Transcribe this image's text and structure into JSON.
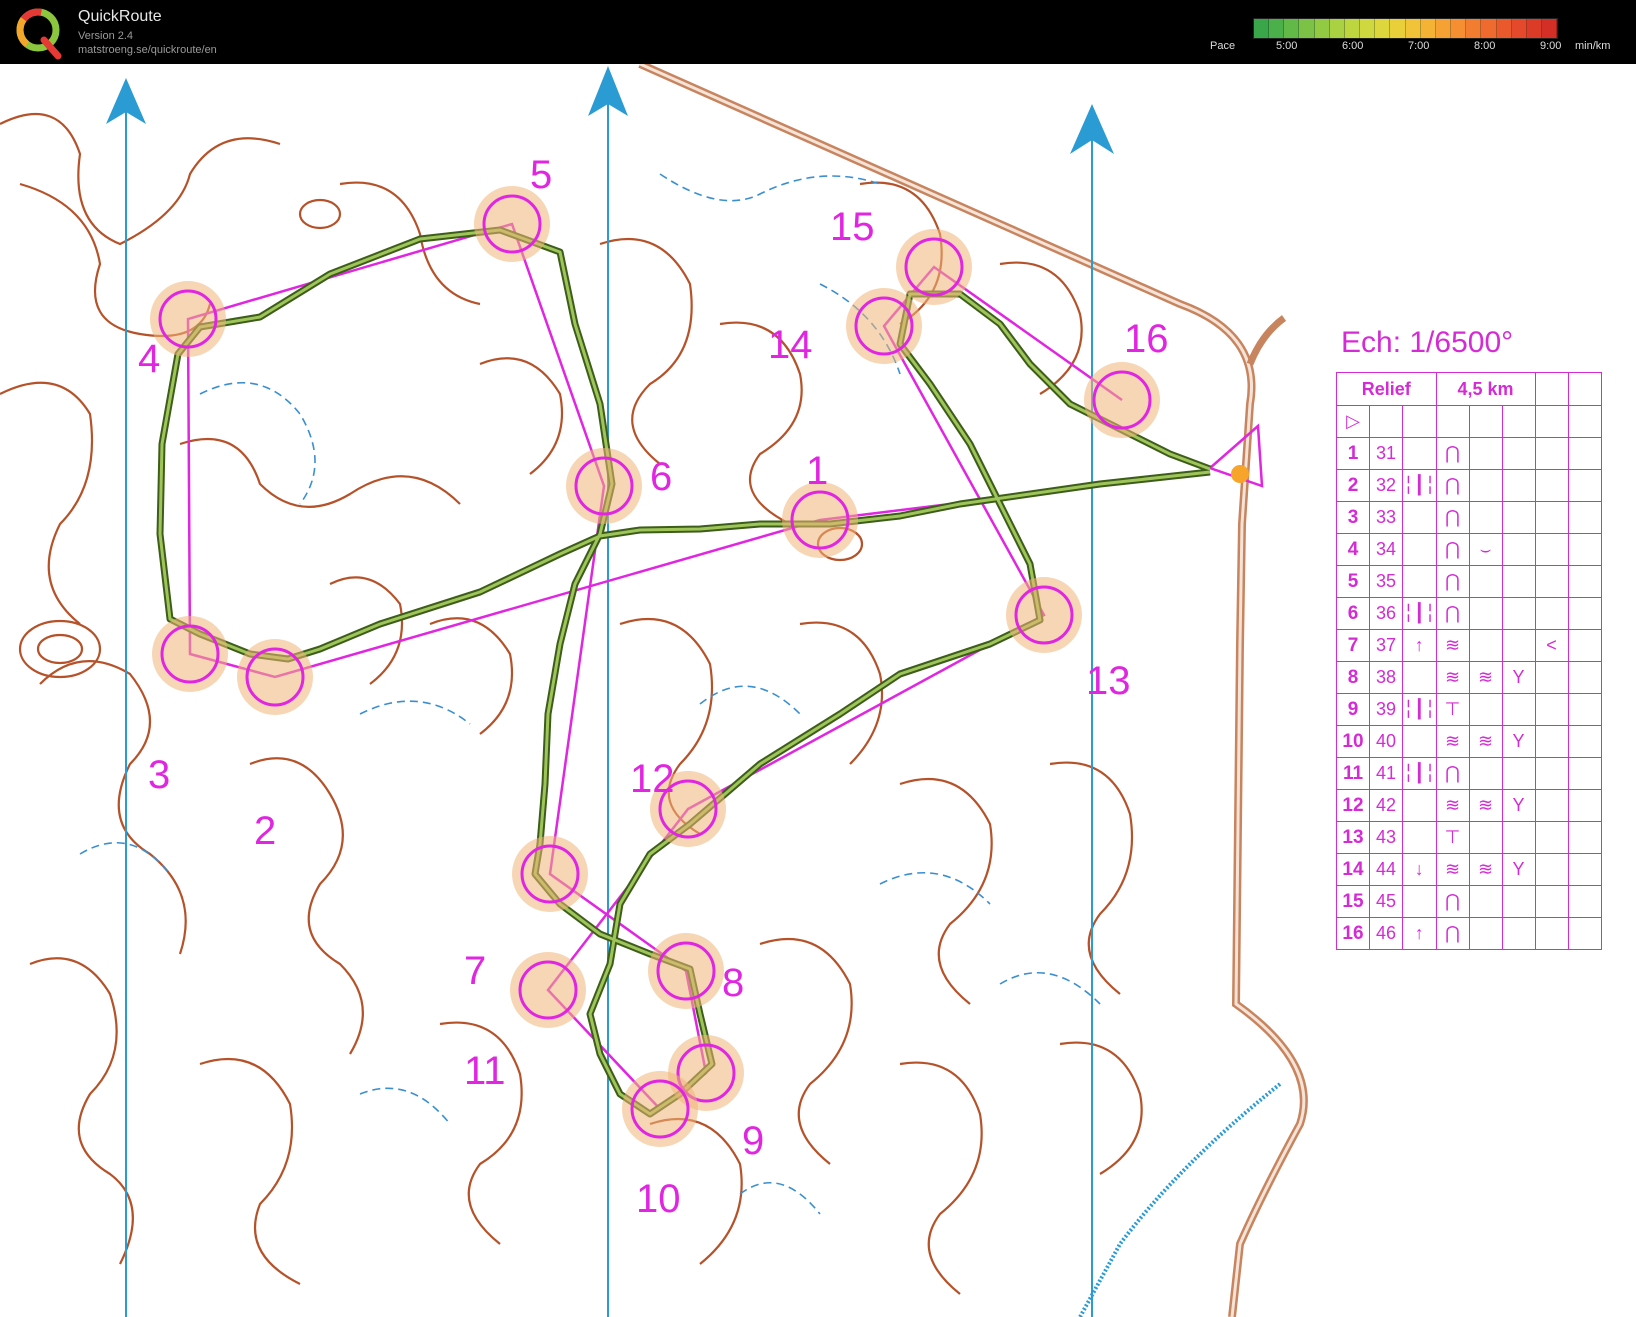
{
  "app": {
    "title": "QuickRoute",
    "version": "Version 2.4",
    "url": "matstroeng.se/quickroute/en"
  },
  "pace_scale": {
    "label": "Pace",
    "ticks": [
      "5:00",
      "6:00",
      "7:00",
      "8:00",
      "9:00"
    ],
    "unit": "min/km",
    "colors": [
      "#3aa64a",
      "#4cb04a",
      "#62b948",
      "#7bc246",
      "#93ca44",
      "#a9d142",
      "#bdd640",
      "#cfd83e",
      "#ddd63c",
      "#e9cf3a",
      "#f1c338",
      "#f5b336",
      "#f6a134",
      "#f58f32",
      "#f27c30",
      "#ee6a2e",
      "#e9592c",
      "#e3492a",
      "#dc3b28",
      "#d42f26"
    ]
  },
  "map": {
    "controls": [
      {
        "num": "1"
      },
      {
        "num": "2"
      },
      {
        "num": "3"
      },
      {
        "num": "4"
      },
      {
        "num": "5"
      },
      {
        "num": "6"
      },
      {
        "num": "7"
      },
      {
        "num": "8"
      },
      {
        "num": "9"
      },
      {
        "num": "10"
      },
      {
        "num": "11"
      },
      {
        "num": "12"
      },
      {
        "num": "13"
      },
      {
        "num": "14"
      },
      {
        "num": "15"
      },
      {
        "num": "16"
      }
    ],
    "colors": {
      "course": "#e026e0",
      "contour": "#b5522a",
      "water": "#3a8fd0",
      "route": "#5c8a2c",
      "road": "#c8845e",
      "north_line": "#2b9bd4"
    }
  },
  "description_sheet": {
    "scale": "Ech: 1/6500°",
    "header": {
      "climb": "Relief",
      "length": "4,5 km"
    },
    "start_symbol": "▷",
    "rows": [
      {
        "n": "1",
        "code": "31",
        "c": "",
        "d": "⋂",
        "e": "",
        "f": "",
        "g": ""
      },
      {
        "n": "2",
        "code": "32",
        "c": "╎┃╎",
        "d": "⋂",
        "e": "",
        "f": "",
        "g": ""
      },
      {
        "n": "3",
        "code": "33",
        "c": "",
        "d": "⋂",
        "e": "",
        "f": "",
        "g": ""
      },
      {
        "n": "4",
        "code": "34",
        "c": "",
        "d": "⋂",
        "e": "⌣",
        "f": "",
        "g": ""
      },
      {
        "n": "5",
        "code": "35",
        "c": "",
        "d": "⋂",
        "e": "",
        "f": "",
        "g": ""
      },
      {
        "n": "6",
        "code": "36",
        "c": "╎┃╎",
        "d": "⋂",
        "e": "",
        "f": "",
        "g": ""
      },
      {
        "n": "7",
        "code": "37",
        "c": "↑",
        "d": "≋",
        "e": "",
        "f": "",
        "g": "<"
      },
      {
        "n": "8",
        "code": "38",
        "c": "",
        "d": "≋",
        "e": "≋",
        "f": "Y",
        "g": ""
      },
      {
        "n": "9",
        "code": "39",
        "c": "╎┃╎",
        "d": "⊤",
        "e": "",
        "f": "",
        "g": ""
      },
      {
        "n": "10",
        "code": "40",
        "c": "",
        "d": "≋",
        "e": "≋",
        "f": "Y",
        "g": ""
      },
      {
        "n": "11",
        "code": "41",
        "c": "╎┃╎",
        "d": "⋂",
        "e": "",
        "f": "",
        "g": ""
      },
      {
        "n": "12",
        "code": "42",
        "c": "",
        "d": "≋",
        "e": "≋",
        "f": "Y",
        "g": ""
      },
      {
        "n": "13",
        "code": "43",
        "c": "",
        "d": "⊤",
        "e": "",
        "f": "",
        "g": ""
      },
      {
        "n": "14",
        "code": "44",
        "c": "↓",
        "d": "≋",
        "e": "≋",
        "f": "Y",
        "g": ""
      },
      {
        "n": "15",
        "code": "45",
        "c": "",
        "d": "⋂",
        "e": "",
        "f": "",
        "g": ""
      },
      {
        "n": "16",
        "code": "46",
        "c": "↑",
        "d": "⋂",
        "e": "",
        "f": "",
        "g": ""
      }
    ]
  }
}
